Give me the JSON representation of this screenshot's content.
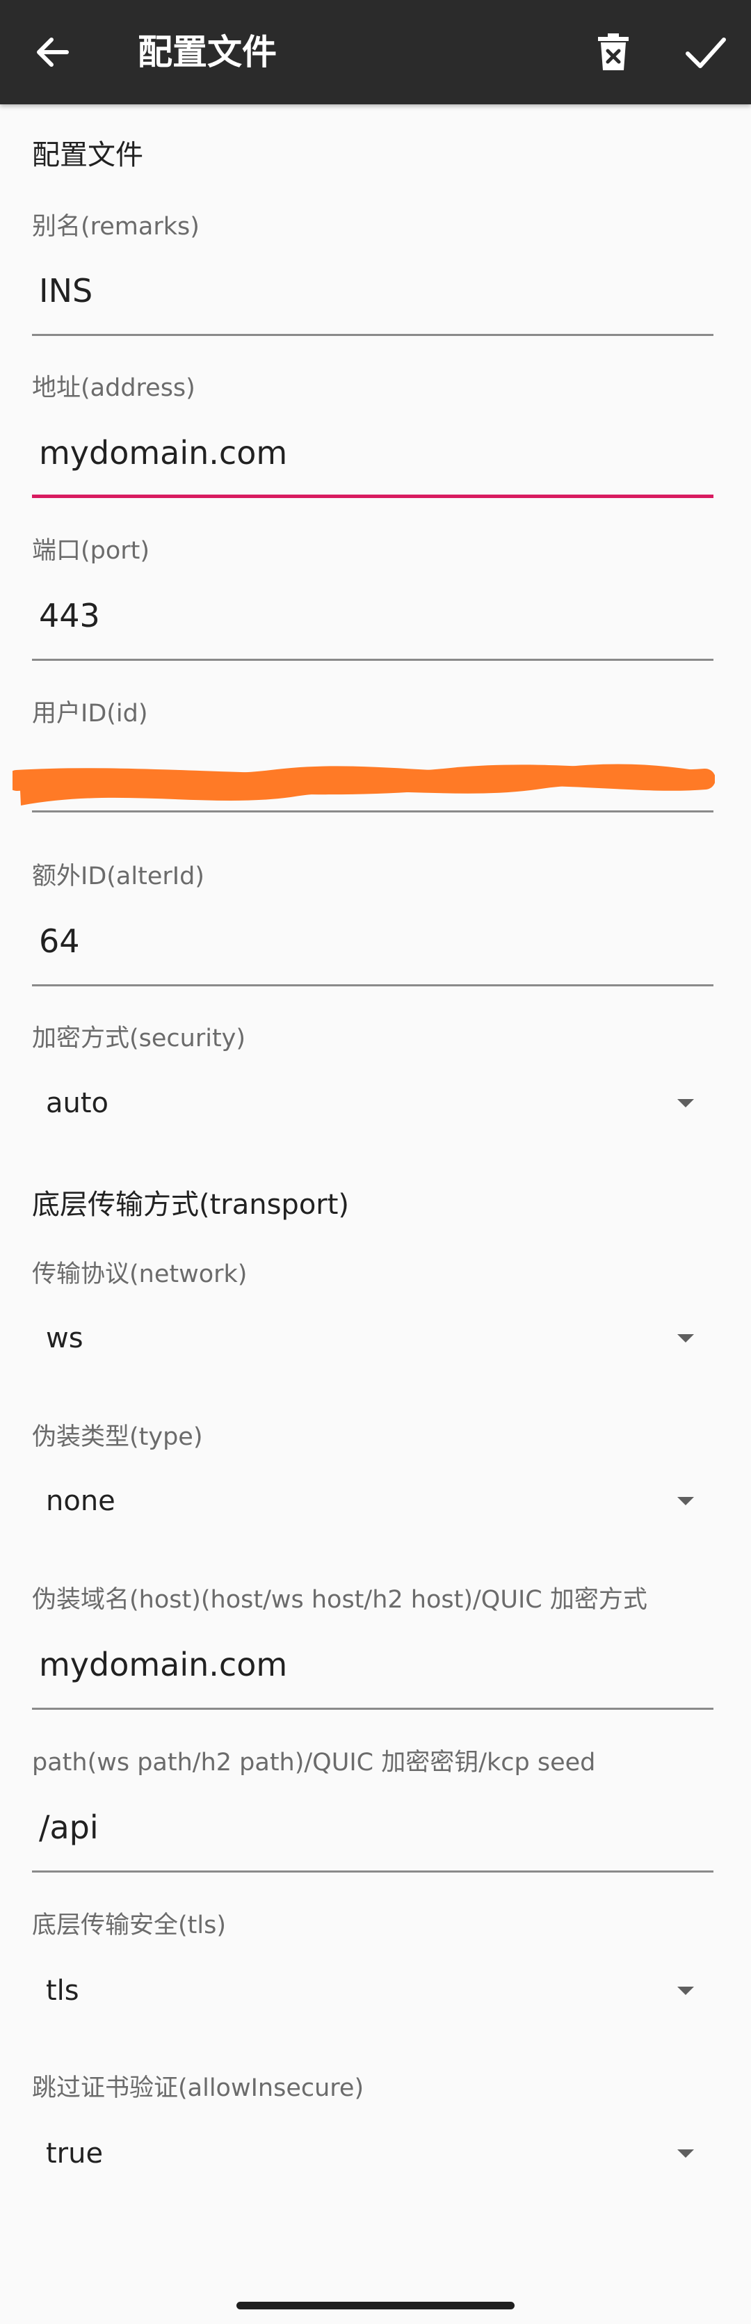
{
  "appbar": {
    "title": "配置文件",
    "icons": [
      "back-arrow-icon",
      "delete-icon",
      "check-icon"
    ]
  },
  "sections": {
    "config": "配置文件",
    "transport": "底层传输方式(transport)"
  },
  "fields": {
    "remarks": {
      "label": "别名(remarks)",
      "value": "INS"
    },
    "address": {
      "label": "地址(address)",
      "value": "mydomain.com"
    },
    "port": {
      "label": "端口(port)",
      "value": "443"
    },
    "id": {
      "label": "用户ID(id)",
      "value": ""
    },
    "alterId": {
      "label": "额外ID(alterId)",
      "value": "64"
    },
    "host": {
      "label": "伪装域名(host)(host/ws host/h2 host)/QUIC 加密方式",
      "value": "mydomain.com"
    },
    "path": {
      "label": "path(ws path/h2 path)/QUIC 加密密钥/kcp seed",
      "value": "/api"
    }
  },
  "spinners": {
    "security": {
      "label": "加密方式(security)",
      "value": "auto"
    },
    "network": {
      "label": "传输协议(network)",
      "value": "ws"
    },
    "type": {
      "label": "伪装类型(type)",
      "value": "none"
    },
    "tls": {
      "label": "底层传输安全(tls)",
      "value": "tls"
    },
    "allowInsecure": {
      "label": "跳过证书验证(allowInsecure)",
      "value": "true"
    }
  },
  "colors": {
    "appbar": "#2b2b2b",
    "focus_underline": "#d81b60",
    "redaction": "#ff7a26"
  }
}
